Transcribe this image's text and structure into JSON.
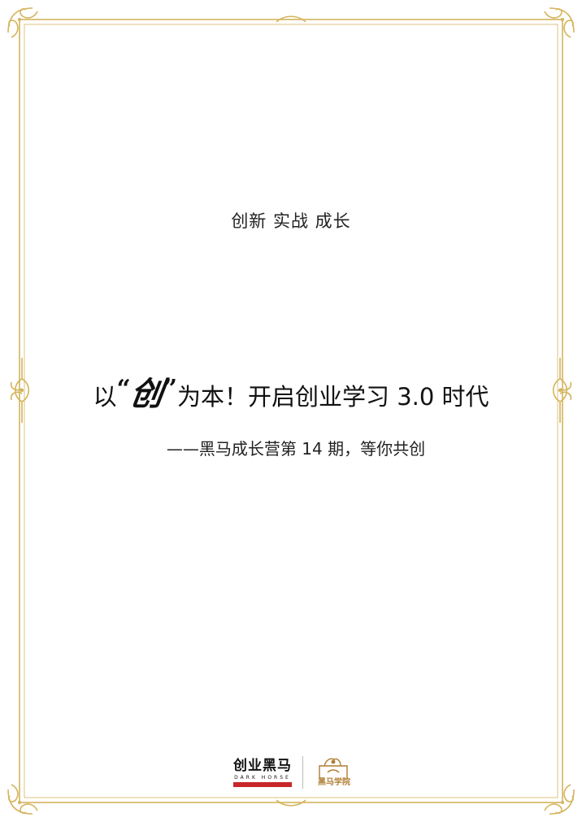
{
  "tagline": "创新 实战 成长",
  "headline": {
    "prefix": "以",
    "quote_open": "“",
    "hero_char": "创",
    "quote_close": "”",
    "suffix": "为本！开启创业学习 3.0 时代"
  },
  "subline": "——黑马成长营第 14 期，等你共创",
  "logos": {
    "dark_horse_cn": "创业黑马",
    "dark_horse_en": "DARK HORSE",
    "school_name": "黑马学院"
  },
  "colors": {
    "frame_gold": "#d4b45c",
    "frame_gold_dark": "#b8923a",
    "brand_red": "#c8262a"
  }
}
